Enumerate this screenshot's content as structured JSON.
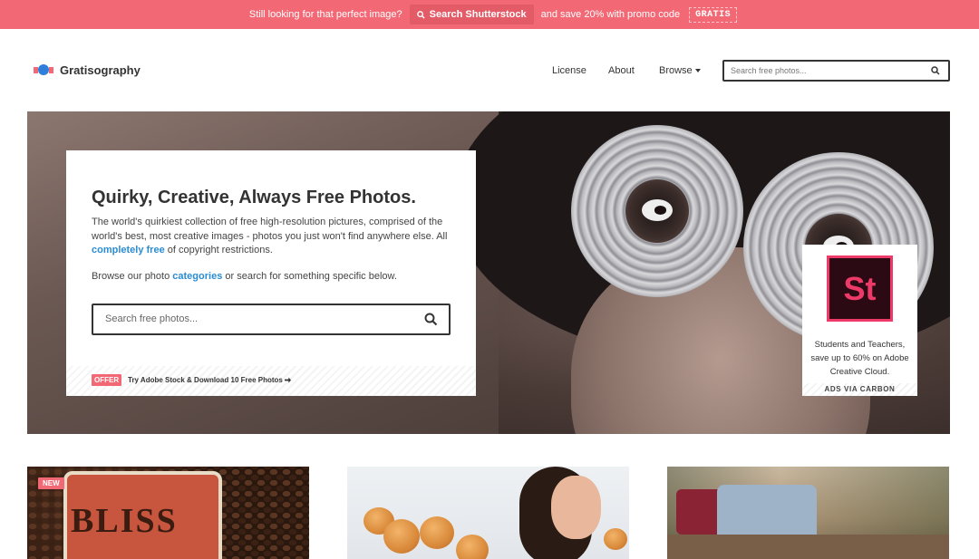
{
  "promo": {
    "lead": "Still looking for that perfect image?",
    "button": "Search Shutterstock",
    "tail": "and save 20% with promo code",
    "code": "GRATIS"
  },
  "header": {
    "logo": "Gratisography",
    "nav": {
      "license": "License",
      "about": "About",
      "browse": "Browse"
    },
    "search_placeholder": "Search free photos..."
  },
  "hero": {
    "title": "Quirky, Creative, Always Free Photos.",
    "description_pre": "The world's quirkiest collection of free high-resolution pictures, comprised of the world's best, most creative images - photos you just won't find anywhere else. All ",
    "description_link": "completely free",
    "description_post": " of copyright restrictions.",
    "browse_pre": "Browse our photo ",
    "browse_link": "categories",
    "browse_post": " or search for something specific below.",
    "search_placeholder": "Search free photos...",
    "offer_badge": "OFFER",
    "offer_text": "Try Adobe Stock & Download 10 Free Photos"
  },
  "ad": {
    "logo_text": "St",
    "text": "Students and Teachers, save up to 60% on Adobe Creative Cloud.",
    "footer": "ADS VIA CARBON"
  },
  "thumbnails": {
    "first_badge": "NEW",
    "first_can_text": "BLISS"
  },
  "colors": {
    "accent": "#f26874",
    "link": "#2a8cd3",
    "logo_blue": "#2e7fdc"
  }
}
